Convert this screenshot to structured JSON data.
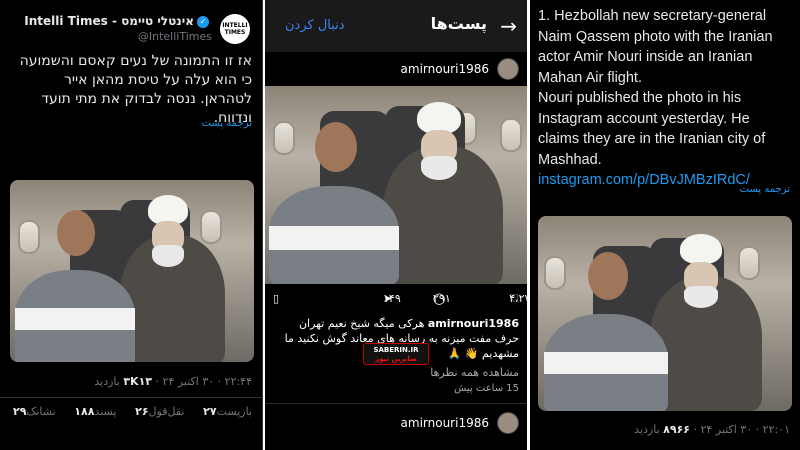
{
  "panel1": {
    "avatar_text": "INTELLI TIMES",
    "display_name": "אינטלי טיימס - Intelli Times",
    "handle": "@IntelliTimes",
    "body": "אז זו התמונה של נעים קאסם והשמועה כי הוא עלה על טיסת מהאן אייר לטהראן. ננסה לבדוק את מתי תועד ונדווח.",
    "translate": "ترجمه پست",
    "meta_time": "۲۲:۴۴ · ۳۰ اکتبر ۲۴ ·",
    "meta_views_value": "۳K۱۳",
    "meta_views_label": "بازدید",
    "stats": [
      {
        "value": "۲۷",
        "label": "بازپست"
      },
      {
        "value": "۲۶",
        "label": "نقل‌قول"
      },
      {
        "value": "۱۸۸",
        "label": "پسند"
      },
      {
        "value": "۲۹",
        "label": "نشانک"
      }
    ]
  },
  "panel2": {
    "back_icon": "arrow-right-icon",
    "title": "پست‌ها",
    "follow": "دنبال کردن",
    "username": "amirnouri1986",
    "likes": "۴،۲۷۹",
    "comments": "۲۹۱",
    "shares": "۱۴۹",
    "caption_user": "amirnouri1986",
    "caption_text": "هرکی میگه شیخ نعیم تهران حرف مفت میزنه به رسانه های معاند گوش نکنید ما مشهدیم 👋 🙏",
    "watermark_top": "SABERIN.IR",
    "watermark_bottom": "صابرین نیوز",
    "view_comments": "مشاهده همه نظرها",
    "time": "15 ساعت پیش",
    "username2": "amirnouri1986"
  },
  "panel3": {
    "body_lines": [
      "1. Hezbollah new secretary-general",
      "Naim Qassem photo with the Iranian",
      "actor Amir Nouri inside an Iranian",
      "Mahan Air flight.",
      "Nouri published the photo in his",
      "Instagram account yesterday. He",
      "claims they are in the Iranian city of",
      "Mashhad."
    ],
    "link": "instagram.com/p/DBvJMBzIRdC/",
    "translate": "ترجمه پست",
    "meta_time": "۲۲:۰۱ · ۳۰ اکتبر ۲۴ ·",
    "meta_views_value": "۸۹۶۶",
    "meta_views_label": "بازدید"
  }
}
